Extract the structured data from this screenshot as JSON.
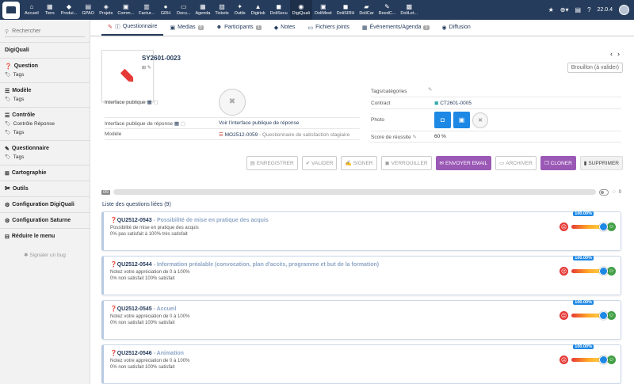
{
  "topbar": {
    "menu": [
      {
        "icon": "home-icon",
        "glyph": "⌂",
        "label": "Accueil"
      },
      {
        "icon": "building-icon",
        "glyph": "▦",
        "label": "Tiers"
      },
      {
        "icon": "cube-icon",
        "glyph": "◆",
        "label": "Produi..."
      },
      {
        "icon": "chart-icon",
        "glyph": "▤",
        "label": "GPAO"
      },
      {
        "icon": "project-icon",
        "glyph": "◈",
        "label": "Projets"
      },
      {
        "icon": "briefcase-icon",
        "glyph": "▣",
        "label": "Comm..."
      },
      {
        "icon": "invoice-icon",
        "glyph": "▥",
        "label": "Factur..."
      },
      {
        "icon": "users-icon",
        "glyph": "●",
        "label": "GRH"
      },
      {
        "icon": "document-icon",
        "glyph": "▭",
        "label": "Docu..."
      },
      {
        "icon": "calendar-icon",
        "glyph": "▦",
        "label": "Agenda"
      },
      {
        "icon": "ticket-icon",
        "glyph": "▧",
        "label": "Tickets"
      },
      {
        "icon": "tools-icon",
        "glyph": "✦",
        "label": "Outils"
      },
      {
        "icon": "digirisk-icon",
        "glyph": "▲",
        "label": "Digirisk"
      },
      {
        "icon": "dolisecu-icon",
        "glyph": "◼",
        "label": "DoliSecu"
      },
      {
        "icon": "digiquali-icon",
        "glyph": "◉",
        "label": "DigiQuali"
      },
      {
        "icon": "dolimeet-icon",
        "glyph": "▣",
        "label": "DoliMeet"
      },
      {
        "icon": "dolisirh-icon",
        "glyph": "◼",
        "label": "DoliSIRH"
      },
      {
        "icon": "dolicar-icon",
        "glyph": "▰",
        "label": "DoliCar"
      },
      {
        "icon": "reedc-icon",
        "glyph": "✎",
        "label": "ReedC..."
      },
      {
        "icon": "dolilet-icon",
        "glyph": "▩",
        "label": "DoliLet..."
      }
    ],
    "active_index": 14,
    "version": "22.0.4"
  },
  "sidebar": {
    "search_placeholder": "Rechercher",
    "app_title": "DigiQuali",
    "sections": [
      {
        "icon": "question-icon",
        "glyph": "❓",
        "label": "Question",
        "subs": [
          "Tags"
        ]
      },
      {
        "icon": "list-icon",
        "glyph": "☰",
        "label": "Modèle",
        "subs": [
          "Tags"
        ]
      },
      {
        "icon": "list-icon",
        "glyph": "☰",
        "label": "Contrôle",
        "subs": [
          "Contrôle Réponse",
          "Tags"
        ]
      },
      {
        "icon": "pen-icon",
        "glyph": "✎",
        "label": "Questionnaire",
        "subs": [
          "Tags"
        ]
      },
      {
        "icon": "sitemap-icon",
        "glyph": "⊞",
        "label": "Cartographie",
        "subs": []
      },
      {
        "icon": "wrench-icon",
        "glyph": "✀",
        "label": "Outils",
        "subs": []
      },
      {
        "icon": "gear-icon",
        "glyph": "⚙",
        "label": "Configuration DigiQuali",
        "subs": []
      },
      {
        "icon": "gear-icon",
        "glyph": "⚙",
        "label": "Configuration Saturne",
        "subs": []
      },
      {
        "icon": "collapse-icon",
        "glyph": "⊟",
        "label": "Réduire le menu",
        "subs": []
      }
    ],
    "sub_icon_glyph": "🏷",
    "bug_label": "Signaler un bug"
  },
  "tabs": [
    {
      "label": "Questionnaire",
      "count": ""
    },
    {
      "label": "Medias",
      "count": "0"
    },
    {
      "label": "Participants",
      "count": "1"
    },
    {
      "label": "Notes",
      "count": ""
    },
    {
      "label": "Fichiers joints",
      "count": ""
    },
    {
      "label": "Événements/Agenda",
      "count": "1"
    },
    {
      "label": "Diffusion",
      "count": ""
    }
  ],
  "object": {
    "ref": "SY2601-0023",
    "status": "Brouillon (à valider)"
  },
  "fields_left": [
    {
      "key": "Interface publique",
      "value": ""
    },
    {
      "key": "Interface publique de réponse",
      "value": "Voir l'interface publique de réponse"
    },
    {
      "key": "Modèle",
      "value": "MO2512-0059",
      "value_extra": " - Questionnaire de satisfaction stagiaire"
    }
  ],
  "fields_right": {
    "tags_label": "Tags/catégories",
    "contract_label": "Contract",
    "contract_value": "CT2601-0005",
    "photo_label": "Photo",
    "score_label": "Score de réussite",
    "score_value": "60 %"
  },
  "actions": [
    "Enregistrer",
    "Valider",
    "Signer",
    "Verrouiller",
    "Envoyer email",
    "Archiver",
    "Cloner",
    "Supprimer"
  ],
  "progress": {
    "badge": "0/9",
    "value": 0,
    "count_label": "0"
  },
  "list_title": "Liste des questions liées (9)",
  "questions": [
    {
      "ref": "QU2512-0543",
      "title": "Possibilité de mise en pratique des acquis",
      "desc1": "Possibilité de mise en pratique des acquis",
      "desc2": "0% pas satisfait à 100% très satisfait",
      "percent": "100.00%",
      "value": 1.0
    },
    {
      "ref": "QU2512-0544",
      "title": "Information préalable (convocation, plan d'accès, programme et but de la formation)",
      "desc1": "Notez votre appréciation de 0 à 100%",
      "desc2": "0% non satisfait 100% satisfait",
      "percent": "100.00%",
      "value": 1.0
    },
    {
      "ref": "QU2512-0545",
      "title": "Accueil",
      "desc1": "Notez votre appréciation de 0 à 100%",
      "desc2": "0% non satisfait 100% satisfait",
      "percent": "100.00%",
      "value": 1.0
    },
    {
      "ref": "QU2512-0546",
      "title": "Animation",
      "desc1": "Notez votre appréciation de 0 à 100%",
      "desc2": "0% non satisfait 100% satisfait",
      "percent": "100.00%",
      "value": 1.0
    }
  ]
}
